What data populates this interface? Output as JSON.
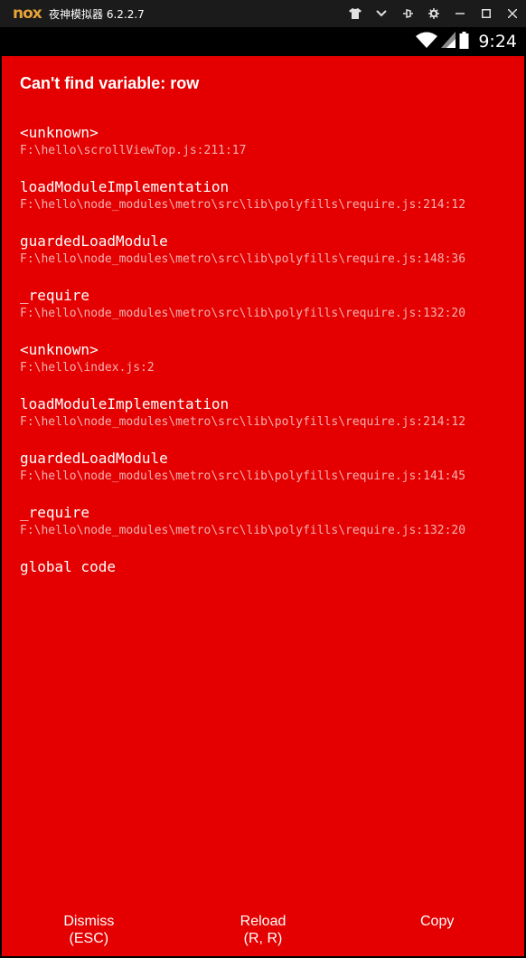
{
  "window": {
    "logo_text": "nox",
    "title": "夜神模拟器 6.2.2.7"
  },
  "status_bar": {
    "time": "9:24"
  },
  "error": {
    "title": "Can't find variable: row",
    "frames": [
      {
        "method": "<unknown>",
        "file": "F:\\hello\\scrollViewTop.js:211:17"
      },
      {
        "method": "loadModuleImplementation",
        "file": "F:\\hello\\node_modules\\metro\\src\\lib\\polyfills\\require.js:214:12"
      },
      {
        "method": "guardedLoadModule",
        "file": "F:\\hello\\node_modules\\metro\\src\\lib\\polyfills\\require.js:148:36"
      },
      {
        "method": "_require",
        "file": "F:\\hello\\node_modules\\metro\\src\\lib\\polyfills\\require.js:132:20"
      },
      {
        "method": "<unknown>",
        "file": "F:\\hello\\index.js:2"
      },
      {
        "method": "loadModuleImplementation",
        "file": "F:\\hello\\node_modules\\metro\\src\\lib\\polyfills\\require.js:214:12"
      },
      {
        "method": "guardedLoadModule",
        "file": "F:\\hello\\node_modules\\metro\\src\\lib\\polyfills\\require.js:141:45"
      },
      {
        "method": "_require",
        "file": "F:\\hello\\node_modules\\metro\\src\\lib\\polyfills\\require.js:132:20"
      },
      {
        "method": "global code",
        "file": ""
      }
    ]
  },
  "buttons": {
    "dismiss": {
      "label": "Dismiss",
      "shortcut": "(ESC)"
    },
    "reload": {
      "label": "Reload",
      "shortcut": "(R, R)"
    },
    "copy": {
      "label": "Copy",
      "shortcut": ""
    }
  },
  "colors": {
    "redbox_bg": "#e40000",
    "file_text": "#f5b0b0",
    "titlebar_bg": "#1b1b1b",
    "logo": "#e8a33a"
  },
  "icons": {
    "titlebar": [
      "shirt-icon",
      "chevron-down-icon",
      "pin-icon",
      "gear-icon",
      "minimize-icon",
      "maximize-icon",
      "close-icon"
    ],
    "status": [
      "wifi-icon",
      "cell-signal-icon",
      "battery-icon"
    ]
  }
}
